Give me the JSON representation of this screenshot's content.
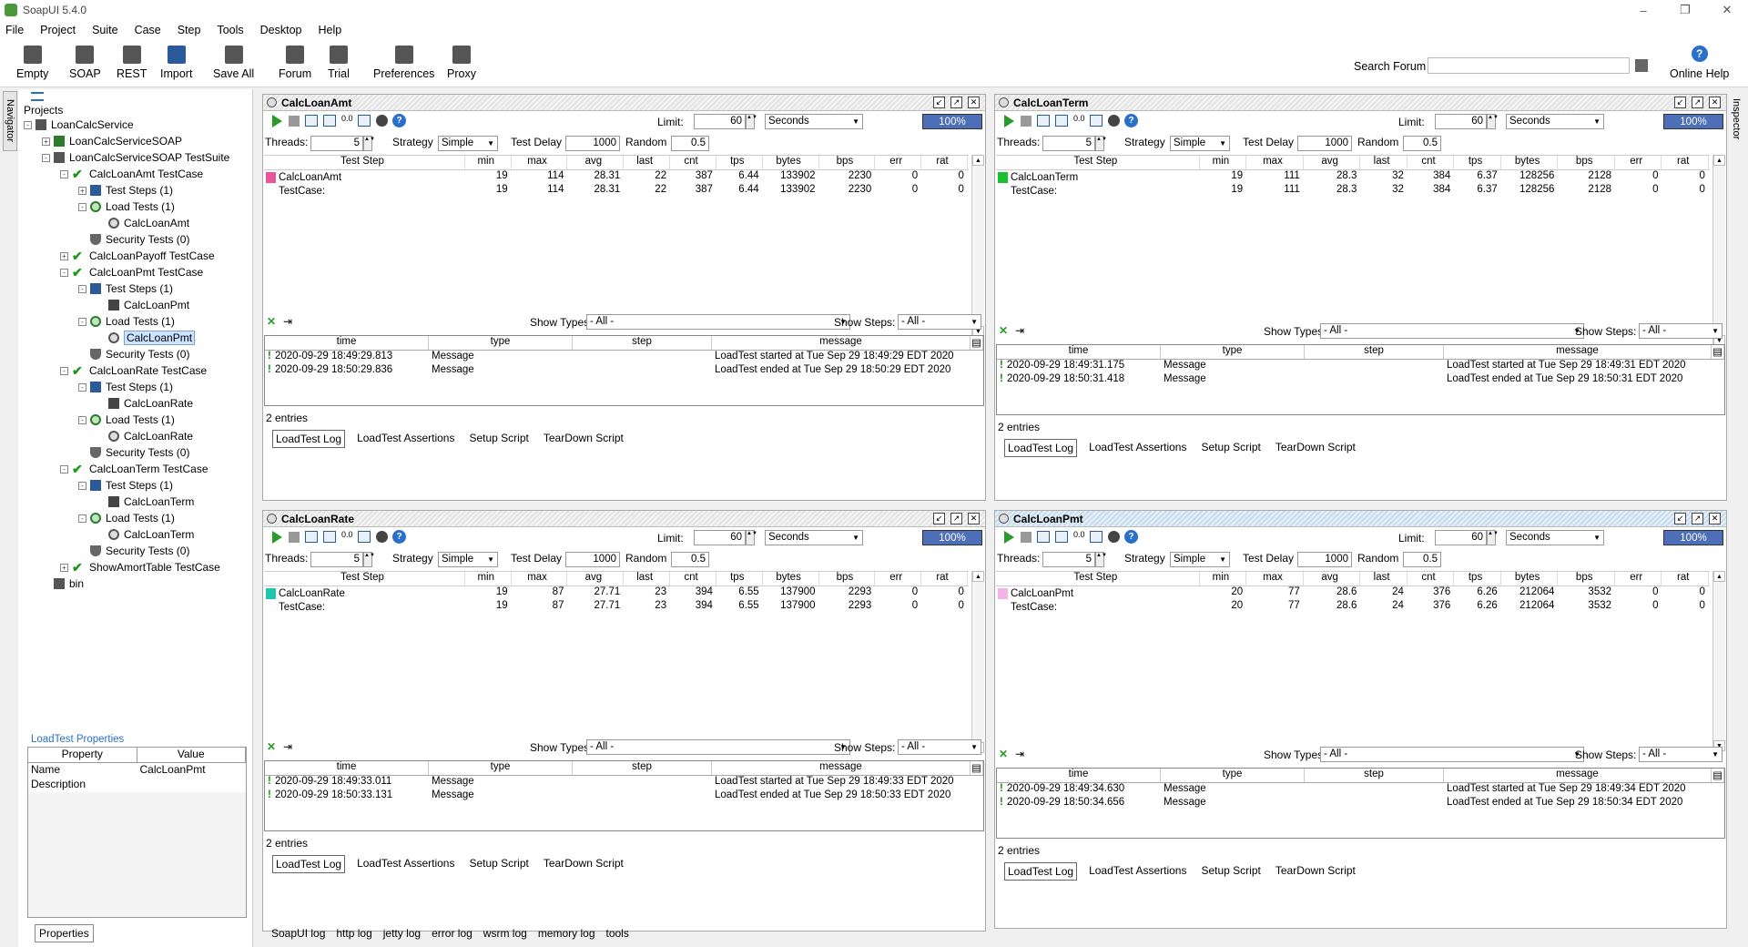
{
  "app": {
    "title": "SoapUI 5.4.0"
  },
  "menu": [
    "File",
    "Project",
    "Suite",
    "Case",
    "Step",
    "Tools",
    "Desktop",
    "Help"
  ],
  "toolbar": {
    "items": [
      {
        "label": "Empty",
        "icon": "empty-project-icon"
      },
      {
        "label": "SOAP",
        "icon": "soap-icon"
      },
      {
        "label": "REST",
        "icon": "rest-icon"
      },
      {
        "label": "Import",
        "icon": "import-icon"
      },
      {
        "label": "Save All",
        "icon": "save-all-icon"
      },
      {
        "label": "Forum",
        "icon": "forum-icon"
      },
      {
        "label": "Trial",
        "icon": "trial-icon"
      },
      {
        "label": "Preferences",
        "icon": "gear-icon"
      },
      {
        "label": "Proxy",
        "icon": "proxy-icon"
      }
    ],
    "search_label": "Search Forum",
    "help_label": "Online Help"
  },
  "side_tabs": {
    "navigator": "Navigator",
    "inspector": "Inspector"
  },
  "navigator": {
    "header": "Projects",
    "tree": [
      {
        "label": "LoanCalcService",
        "level": 0,
        "icon": "folder",
        "exp": "-"
      },
      {
        "label": "LoanCalcServiceSOAP",
        "level": 1,
        "icon": "suite",
        "exp": "+"
      },
      {
        "label": "LoanCalcServiceSOAP TestSuite",
        "level": 1,
        "icon": "suiteg",
        "exp": "-"
      },
      {
        "label": "CalcLoanAmt TestCase",
        "level": 2,
        "icon": "check",
        "exp": "-"
      },
      {
        "label": "Test Steps (1)",
        "level": 3,
        "icon": "steps",
        "exp": "+"
      },
      {
        "label": "Load Tests (1)",
        "level": 3,
        "icon": "load",
        "exp": "-"
      },
      {
        "label": "CalcLoanAmt",
        "level": 4,
        "icon": "gauge",
        "exp": ""
      },
      {
        "label": "Security Tests (0)",
        "level": 3,
        "icon": "sec",
        "exp": ""
      },
      {
        "label": "CalcLoanPayoff TestCase",
        "level": 2,
        "icon": "check",
        "exp": "+"
      },
      {
        "label": "CalcLoanPmt TestCase",
        "level": 2,
        "icon": "check",
        "exp": "-"
      },
      {
        "label": "Test Steps (1)",
        "level": 3,
        "icon": "steps",
        "exp": "-"
      },
      {
        "label": "CalcLoanPmt",
        "level": 4,
        "icon": "calc",
        "exp": ""
      },
      {
        "label": "Load Tests (1)",
        "level": 3,
        "icon": "load",
        "exp": "-"
      },
      {
        "label": "CalcLoanPmt",
        "level": 4,
        "icon": "gauge",
        "exp": "",
        "selected": true
      },
      {
        "label": "Security Tests (0)",
        "level": 3,
        "icon": "sec",
        "exp": ""
      },
      {
        "label": "CalcLoanRate TestCase",
        "level": 2,
        "icon": "check",
        "exp": "-"
      },
      {
        "label": "Test Steps (1)",
        "level": 3,
        "icon": "steps",
        "exp": "-"
      },
      {
        "label": "CalcLoanRate",
        "level": 4,
        "icon": "calc",
        "exp": ""
      },
      {
        "label": "Load Tests (1)",
        "level": 3,
        "icon": "load",
        "exp": "-"
      },
      {
        "label": "CalcLoanRate",
        "level": 4,
        "icon": "gauge",
        "exp": ""
      },
      {
        "label": "Security Tests (0)",
        "level": 3,
        "icon": "sec",
        "exp": ""
      },
      {
        "label": "CalcLoanTerm TestCase",
        "level": 2,
        "icon": "check",
        "exp": "-"
      },
      {
        "label": "Test Steps (1)",
        "level": 3,
        "icon": "steps",
        "exp": "-"
      },
      {
        "label": "CalcLoanTerm",
        "level": 4,
        "icon": "calc",
        "exp": ""
      },
      {
        "label": "Load Tests (1)",
        "level": 3,
        "icon": "load",
        "exp": "-"
      },
      {
        "label": "CalcLoanTerm",
        "level": 4,
        "icon": "gauge",
        "exp": ""
      },
      {
        "label": "Security Tests (0)",
        "level": 3,
        "icon": "sec",
        "exp": ""
      },
      {
        "label": "ShowAmortTable TestCase",
        "level": 2,
        "icon": "check",
        "exp": "+"
      },
      {
        "label": "bin",
        "level": 1,
        "icon": "folder",
        "exp": ""
      }
    ]
  },
  "properties": {
    "title": "LoadTest Properties",
    "headers": [
      "Property",
      "Value"
    ],
    "rows": [
      [
        "Name",
        "CalcLoanPmt"
      ],
      [
        "Description",
        ""
      ]
    ],
    "button": "Properties"
  },
  "common": {
    "limit_label": "Limit:",
    "threads_label": "Threads:",
    "strategy_label": "Strategy",
    "delay_label": "Test Delay",
    "random_label": "Random",
    "show_types": "Show Types:",
    "show_steps": "Show Steps:",
    "all": "- All -",
    "stat_headers": [
      "Test Step",
      "min",
      "max",
      "avg",
      "last",
      "cnt",
      "tps",
      "bytes",
      "bps",
      "err",
      "rat"
    ],
    "log_headers": [
      "time",
      "type",
      "step",
      "message"
    ],
    "tabs": [
      "LoadTest Log",
      "LoadTest Assertions",
      "Setup Script",
      "TearDown Script"
    ]
  },
  "panels": [
    {
      "title": "CalcLoanAmt",
      "limit": "60",
      "unit": "Seconds",
      "progress": "100%",
      "threads": "5",
      "strategy": "Simple",
      "delay": "1000",
      "random": "0.5",
      "color": "#e8559a",
      "rows": [
        [
          "CalcLoanAmt",
          "19",
          "114",
          "28.31",
          "22",
          "387",
          "6.44",
          "133902",
          "2230",
          "0",
          "0"
        ],
        [
          "TestCase:",
          "19",
          "114",
          "28.31",
          "22",
          "387",
          "6.44",
          "133902",
          "2230",
          "0",
          "0"
        ]
      ],
      "log": [
        [
          "2020-09-29 18:49:29.813",
          "Message",
          "",
          "LoadTest started at Tue Sep 29 18:49:29 EDT 2020"
        ],
        [
          "2020-09-29 18:50:29.836",
          "Message",
          "",
          "LoadTest ended at Tue Sep 29 18:50:29 EDT 2020"
        ]
      ],
      "entries": "2 entries",
      "active": false
    },
    {
      "title": "CalcLoanTerm",
      "limit": "60",
      "unit": "Seconds",
      "progress": "100%",
      "threads": "5",
      "strategy": "Simple",
      "delay": "1000",
      "random": "0.5",
      "color": "#19c12e",
      "rows": [
        [
          "CalcLoanTerm",
          "19",
          "111",
          "28.3",
          "32",
          "384",
          "6.37",
          "128256",
          "2128",
          "0",
          "0"
        ],
        [
          "TestCase:",
          "19",
          "111",
          "28.3",
          "32",
          "384",
          "6.37",
          "128256",
          "2128",
          "0",
          "0"
        ]
      ],
      "log": [
        [
          "2020-09-29 18:49:31.175",
          "Message",
          "",
          "LoadTest started at Tue Sep 29 18:49:31 EDT 2020"
        ],
        [
          "2020-09-29 18:50:31.418",
          "Message",
          "",
          "LoadTest ended at Tue Sep 29 18:50:31 EDT 2020"
        ]
      ],
      "entries": "2 entries",
      "active": false
    },
    {
      "title": "CalcLoanRate",
      "limit": "60",
      "unit": "Seconds",
      "progress": "100%",
      "threads": "5",
      "strategy": "Simple",
      "delay": "1000",
      "random": "0.5",
      "color": "#1fc7b0",
      "rows": [
        [
          "CalcLoanRate",
          "19",
          "87",
          "27.71",
          "23",
          "394",
          "6.55",
          "137900",
          "2293",
          "0",
          "0"
        ],
        [
          "TestCase:",
          "19",
          "87",
          "27.71",
          "23",
          "394",
          "6.55",
          "137900",
          "2293",
          "0",
          "0"
        ]
      ],
      "log": [
        [
          "2020-09-29 18:49:33.011",
          "Message",
          "",
          "LoadTest started at Tue Sep 29 18:49:33 EDT 2020"
        ],
        [
          "2020-09-29 18:50:33.131",
          "Message",
          "",
          "LoadTest ended at Tue Sep 29 18:50:33 EDT 2020"
        ]
      ],
      "entries": "2 entries",
      "active": false
    },
    {
      "title": "CalcLoanPmt",
      "limit": "60",
      "unit": "Seconds",
      "progress": "100%",
      "threads": "5",
      "strategy": "Simple",
      "delay": "1000",
      "random": "0.5",
      "color": "#f2b4e8",
      "rows": [
        [
          "CalcLoanPmt",
          "20",
          "77",
          "28.6",
          "24",
          "376",
          "6.26",
          "212064",
          "3532",
          "0",
          "0"
        ],
        [
          "TestCase:",
          "20",
          "77",
          "28.6",
          "24",
          "376",
          "6.26",
          "212064",
          "3532",
          "0",
          "0"
        ]
      ],
      "log": [
        [
          "2020-09-29 18:49:34.630",
          "Message",
          "",
          "LoadTest started at Tue Sep 29 18:49:34 EDT 2020"
        ],
        [
          "2020-09-29 18:50:34.656",
          "Message",
          "",
          "LoadTest ended at Tue Sep 29 18:50:34 EDT 2020"
        ]
      ],
      "entries": "2 entries",
      "active": true
    }
  ],
  "bottom_tabs": [
    "SoapUI log",
    "http log",
    "jetty log",
    "error log",
    "wsrm log",
    "memory log",
    "tools"
  ]
}
